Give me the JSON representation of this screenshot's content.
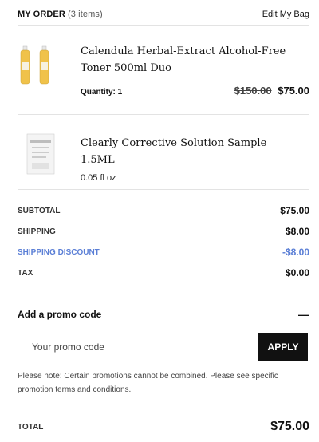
{
  "header": {
    "title": "MY ORDER",
    "count": "(3 items)",
    "edit_link": "Edit My Bag"
  },
  "items": [
    {
      "name": "Calendula Herbal-Extract Alcohol-Free Toner 500ml Duo",
      "detail": "Quantity: 1",
      "old_price": "$150.00",
      "price": "$75.00",
      "thumbnail": "toner-duo-bottles"
    },
    {
      "name": "Clearly Corrective Solution Sample 1.5ML",
      "detail": "0.05 fl oz",
      "thumbnail": "sample-sachet"
    }
  ],
  "summary": {
    "subtotal_label": "SUBTOTAL",
    "subtotal_value": "$75.00",
    "shipping_label": "SHIPPING",
    "shipping_value": "$8.00",
    "discount_label": "SHIPPING DISCOUNT",
    "discount_value": "-$8.00",
    "tax_label": "TAX",
    "tax_value": "$0.00"
  },
  "promo": {
    "title": "Add a promo code",
    "toggle": "—",
    "placeholder": "Your promo code",
    "apply_label": "APPLY",
    "note": "Please note: Certain promotions cannot be combined. Please see specific promotion terms and conditions."
  },
  "total": {
    "label": "TOTAL",
    "value": "$75.00"
  },
  "colors": {
    "discount": "#5b7fd6",
    "button_bg": "#111111"
  }
}
